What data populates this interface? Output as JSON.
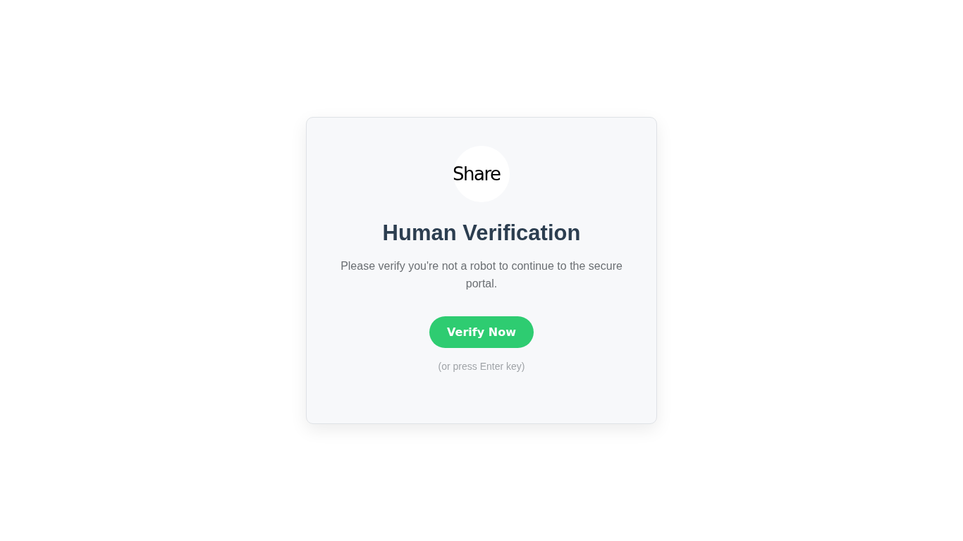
{
  "logo": {
    "text": "Share"
  },
  "title": "Human Verification",
  "message": "Please verify you're not a robot to continue to the secure portal.",
  "button": {
    "label": "Verify Now"
  },
  "hint": "(or press Enter key)"
}
